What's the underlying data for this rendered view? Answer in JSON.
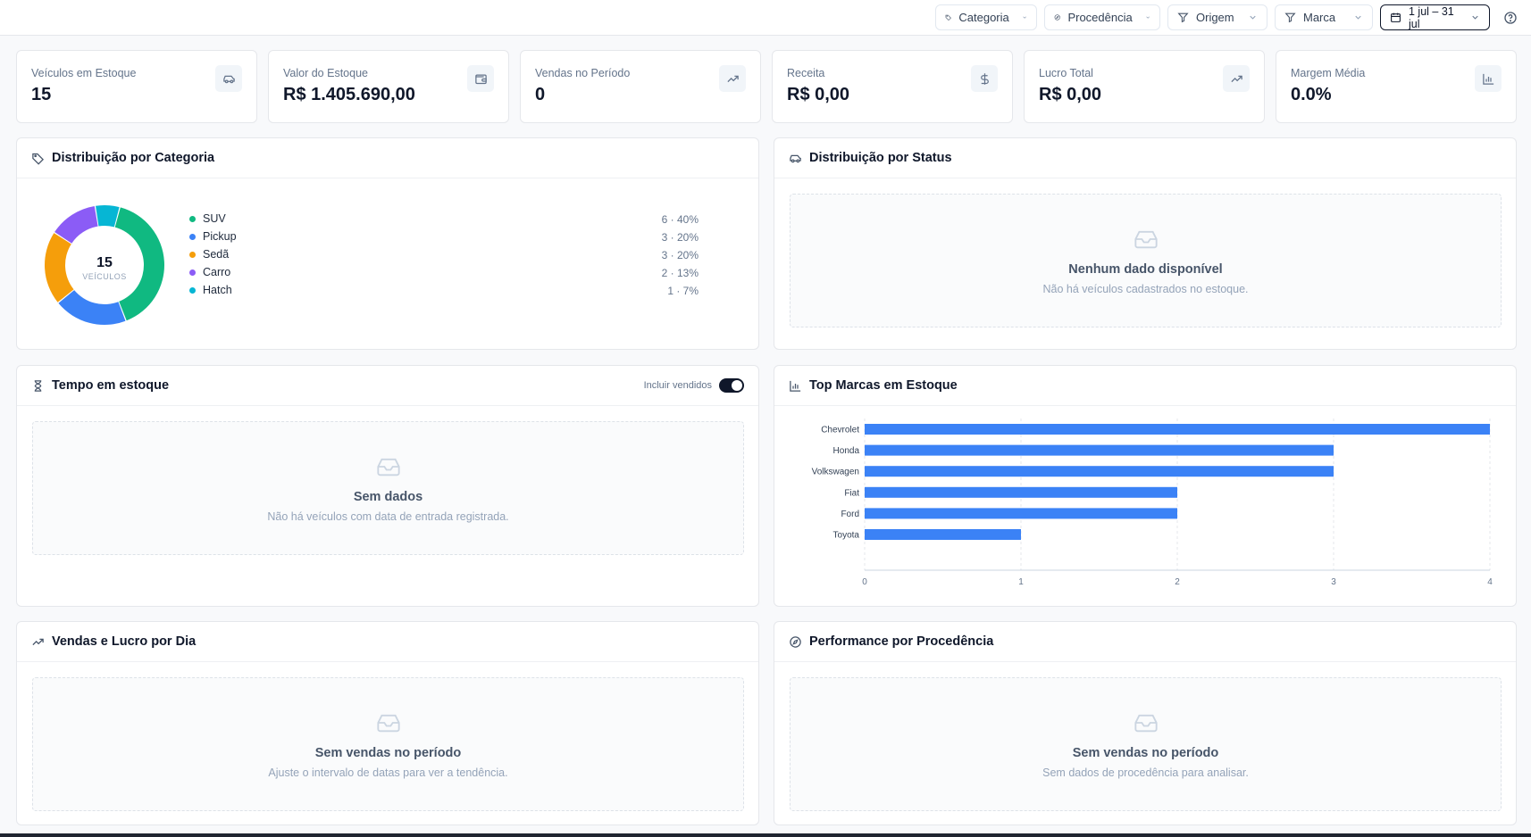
{
  "filters": {
    "categoria": "Categoria",
    "procedencia": "Procedência",
    "origem": "Origem",
    "marca": "Marca",
    "date_range": "1 jul – 31 jul"
  },
  "kpis": [
    {
      "label": "Veículos em Estoque",
      "value": "15",
      "icon": "car-icon"
    },
    {
      "label": "Valor do Estoque",
      "value": "R$ 1.405.690,00",
      "icon": "wallet-icon"
    },
    {
      "label": "Vendas no Período",
      "value": "0",
      "icon": "trending-up-icon"
    },
    {
      "label": "Receita",
      "value": "R$ 0,00",
      "icon": "dollar-icon"
    },
    {
      "label": "Lucro Total",
      "value": "R$ 0,00",
      "icon": "trending-up-icon"
    },
    {
      "label": "Margem Média",
      "value": "0.0%",
      "icon": "bar-chart-icon"
    }
  ],
  "panels": {
    "categoria": {
      "title": "Distribuição por Categoria"
    },
    "status": {
      "title": "Distribuição por Status",
      "empty_title": "Nenhum dado disponível",
      "empty_desc": "Não há veículos cadastrados no estoque."
    },
    "tempo": {
      "title": "Tempo em estoque",
      "toggle_label": "Incluir vendidos",
      "toggle_on": true,
      "empty_title": "Sem dados",
      "empty_desc": "Não há veículos com data de entrada registrada."
    },
    "marcas": {
      "title": "Top Marcas em Estoque"
    },
    "vendas": {
      "title": "Vendas e Lucro por Dia",
      "empty_title": "Sem vendas no período",
      "empty_desc": "Ajuste o intervalo de datas para ver a tendência."
    },
    "procedencia": {
      "title": "Performance por Procedência",
      "empty_title": "Sem vendas no período",
      "empty_desc": "Sem dados de procedência para analisar."
    }
  },
  "chart_data": [
    {
      "type": "pie",
      "center_value": "15",
      "center_label": "VEÍCULOS",
      "categories": [
        "SUV",
        "Pickup",
        "Sedã",
        "Carro",
        "Hatch"
      ],
      "values": [
        6,
        3,
        3,
        2,
        1
      ],
      "stats": [
        "6 · 40%",
        "3 · 20%",
        "3 · 20%",
        "2 · 13%",
        "1 · 7%"
      ],
      "colors": [
        "#10b981",
        "#3b82f6",
        "#f59e0b",
        "#8b5cf6",
        "#06b6d4"
      ]
    },
    {
      "type": "bar",
      "orientation": "horizontal",
      "categories": [
        "Chevrolet",
        "Honda",
        "Volkswagen",
        "Fiat",
        "Ford",
        "Toyota"
      ],
      "values": [
        4,
        3,
        3,
        2,
        2,
        1
      ],
      "xlim": [
        0,
        4
      ],
      "xticks": [
        "0",
        "1",
        "2",
        "3",
        "4"
      ],
      "color": "#3b82f6",
      "grid": true
    }
  ],
  "colors": {
    "accent": "#3b82f6",
    "dark": "#0f172a",
    "muted": "#64748b"
  }
}
